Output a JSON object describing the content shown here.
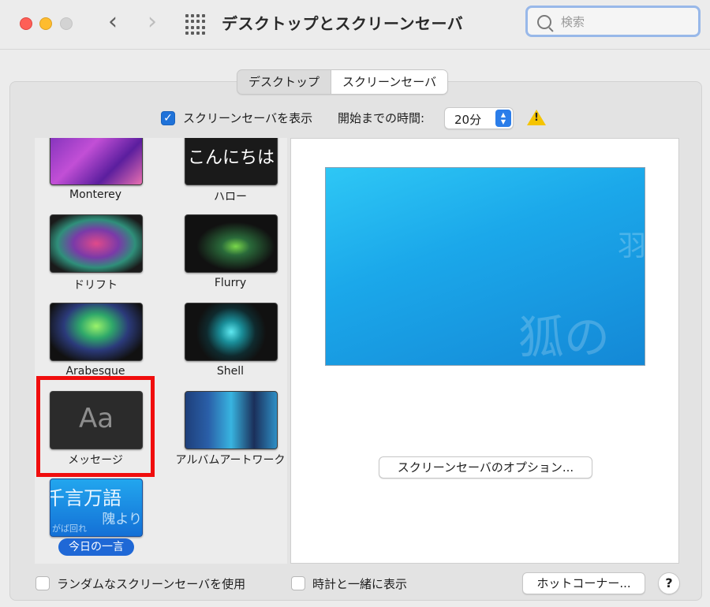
{
  "window": {
    "title": "デスクトップとスクリーンセーバ"
  },
  "search": {
    "placeholder": "検索"
  },
  "tabs": [
    {
      "label": "デスクトップ",
      "active": false
    },
    {
      "label": "スクリーンセーバ",
      "active": true
    }
  ],
  "controls": {
    "show_screensaver_label": "スクリーンセーバを表示",
    "show_screensaver_checked": true,
    "start_after_label": "開始までの時間:",
    "start_after_value": "20分",
    "warning_icon": "warning-icon"
  },
  "screensavers": [
    {
      "name": "Monterey",
      "selected": false
    },
    {
      "name": "ハロー",
      "thumb_text": "こんにちは",
      "selected": false
    },
    {
      "name": "ドリフト",
      "selected": false
    },
    {
      "name": "Flurry",
      "selected": false
    },
    {
      "name": "Arabesque",
      "selected": false
    },
    {
      "name": "Shell",
      "selected": false
    },
    {
      "name": "メッセージ",
      "thumb_text": "Aa",
      "selected": false
    },
    {
      "name": "アルバムアートワーク",
      "selected": false
    },
    {
      "name": "今日の一言",
      "thumb_text_main": "千言万語",
      "thumb_text_sub": "隗より",
      "thumb_text_small": "がば回れ",
      "selected": true
    }
  ],
  "preview": {
    "text_top": "羽",
    "text_bottom": "狐の"
  },
  "options_button": "スクリーンセーバのオプション...",
  "bottom": {
    "random_label": "ランダムなスクリーンセーバを使用",
    "random_checked": false,
    "clock_label": "時計と一緒に表示",
    "clock_checked": false,
    "hot_corners_button": "ホットコーナー...",
    "help_button": "?"
  }
}
